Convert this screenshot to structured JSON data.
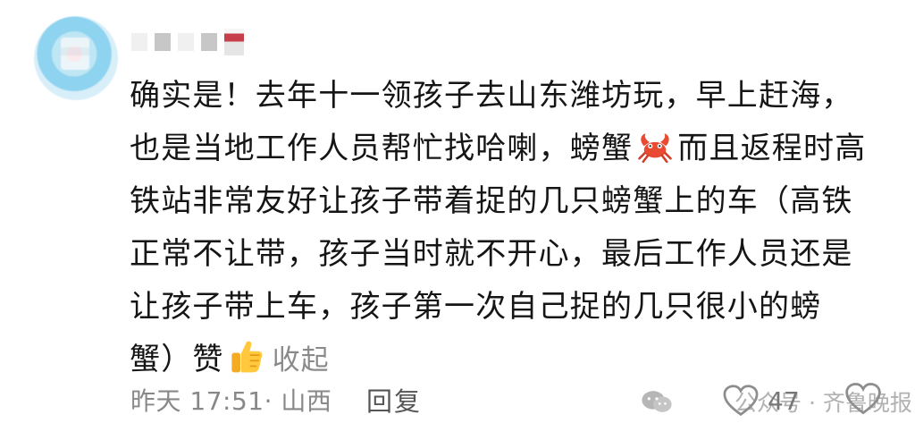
{
  "comment": {
    "lines": [
      "确实是！去年十一领孩子去山东潍坊玩，早上赶海，",
      "也是当地工作人员帮忙找哈喇，螃蟹",
      "而且返程时高",
      "铁站非常友好让孩子带着捉的几只螃蟹上的车（高铁",
      "正常不让带，孩子当时就不开心，最后工作人员还是",
      "让孩子带上车，孩子第一次自己捉的几只很小的螃",
      "蟹）赞"
    ],
    "collapse_label": "收起"
  },
  "meta": {
    "time_location": "昨天 17:51· 山西",
    "reply_label": "回复",
    "like_count": "47"
  },
  "watermark": {
    "source": "公众号 · 齐鲁晚报"
  },
  "icons": {
    "crab": "crab-emoji-icon",
    "thumbs_up": "thumbs-up-emoji-icon",
    "like": "heart-icon",
    "wechat": "wechat-icon"
  }
}
